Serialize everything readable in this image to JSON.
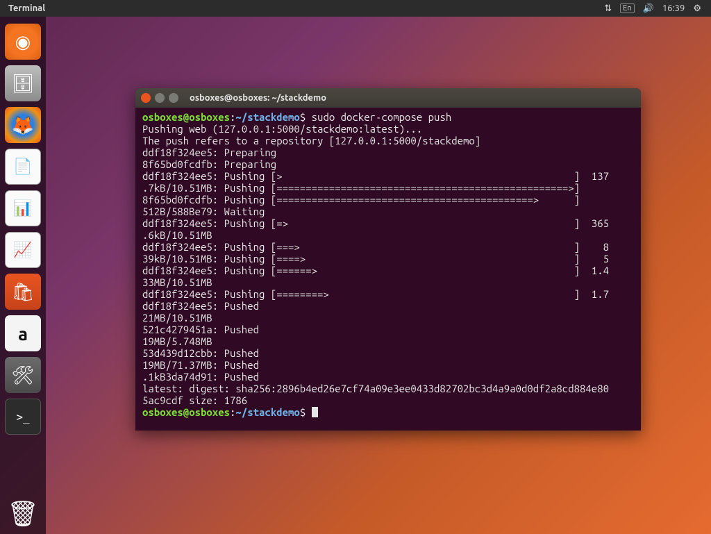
{
  "panel": {
    "app_name": "Terminal",
    "lang": "En",
    "time": "16:39"
  },
  "launcher": {
    "items": [
      {
        "name": "ubuntu-dash",
        "glyph": "◉"
      },
      {
        "name": "files",
        "glyph": "🗄"
      },
      {
        "name": "firefox",
        "glyph": "🦊"
      },
      {
        "name": "libreoffice-writer",
        "glyph": "📄"
      },
      {
        "name": "libreoffice-calc",
        "glyph": "📊"
      },
      {
        "name": "libreoffice-impress",
        "glyph": "📈"
      },
      {
        "name": "ubuntu-software",
        "glyph": "🛍"
      },
      {
        "name": "amazon",
        "glyph": "a"
      },
      {
        "name": "system-settings",
        "glyph": "🛠"
      },
      {
        "name": "terminal",
        "glyph": ">_"
      }
    ],
    "trash_glyph": "🗑"
  },
  "terminal": {
    "title": "osboxes@osboxes: ~/stackdemo",
    "prompt": {
      "userhost": "osboxes@osboxes",
      "colon": ":",
      "path": "~/stackdemo",
      "dollar": "$"
    },
    "command": "sudo docker-compose push",
    "lines": [
      "Pushing web (127.0.0.1:5000/stackdemo:latest)...",
      "The push refers to a repository [127.0.0.1:5000/stackdemo]",
      "ddf18f324ee5: Preparing",
      "8f65bd0fcdfb: Preparing",
      "ddf18f324ee5: Pushing [>                                                  ]  137",
      ".7kB/10.51MB: Pushing [==================================================>]",
      "8f65bd0fcdfb: Pushing [============================================>      ]",
      "512B/588Be79: Waiting",
      "ddf18f324ee5: Pushing [=>                                                 ]  365",
      ".6kB/10.51MB",
      "ddf18f324ee5: Pushing [===>                                               ]    8",
      "39kB/10.51MB: Pushing [====>                                              ]    5",
      "ddf18f324ee5: Pushing [======>                                            ]  1.4",
      "33MB/10.51MB",
      "ddf18f324ee5: Pushing [========>                                          ]  1.7",
      "ddf18f324ee5: Pushed",
      "21MB/10.51MB",
      "521c4279451a: Pushed",
      "19MB/5.748MB",
      "53d439d12cbb: Pushed",
      "19MB/71.37MB: Pushed",
      ".1kB3da74d91: Pushed",
      "latest: digest: sha256:2896b4ed26e7cf74a09e3ee0433d82702bc3d4a9a0d0df2a8cd884e80",
      "5ac9cdf size: 1786"
    ]
  }
}
